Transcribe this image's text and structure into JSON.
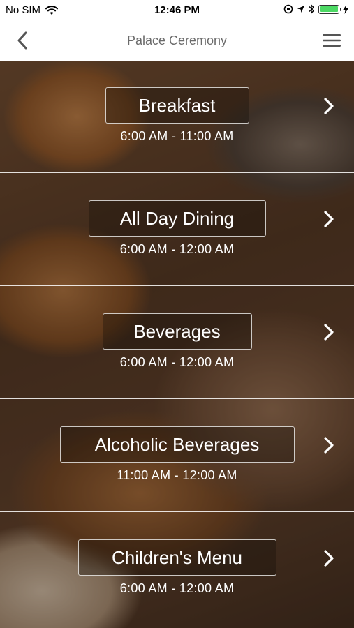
{
  "status": {
    "carrier": "No SIM",
    "time": "12:46 PM",
    "battery_level": 1.0
  },
  "nav": {
    "title": "Palace Ceremony",
    "back_icon": "chevron-left-icon",
    "menu_icon": "hamburger-icon"
  },
  "menus": [
    {
      "label": "Breakfast",
      "hours": "6:00 AM - 11:00 AM"
    },
    {
      "label": "All Day Dining",
      "hours": "6:00 AM - 12:00 AM"
    },
    {
      "label": "Beverages",
      "hours": "6:00 AM - 12:00 AM"
    },
    {
      "label": "Alcoholic Beverages",
      "hours": "11:00 AM - 12:00 AM"
    },
    {
      "label": "Children's Menu",
      "hours": "6:00 AM - 12:00 AM"
    }
  ],
  "colors": {
    "nav_title": "#6b6b6b",
    "battery": "#4cd964",
    "row_text": "#ffffff"
  }
}
